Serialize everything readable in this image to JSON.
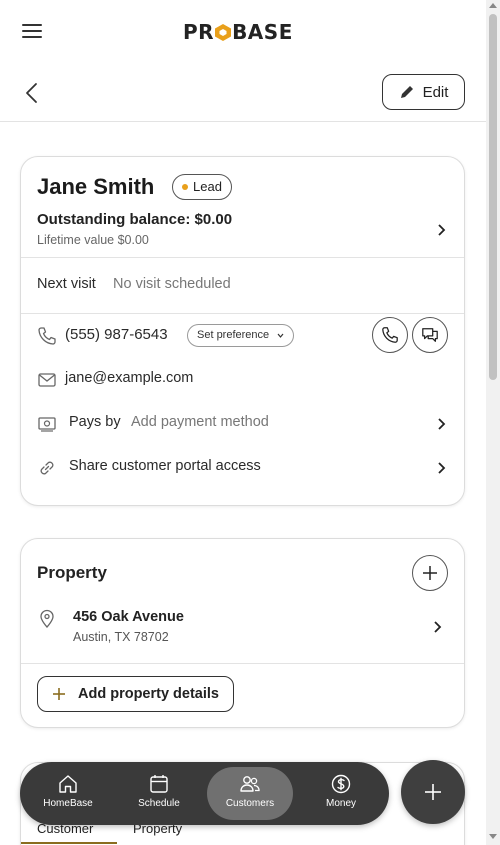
{
  "header": {
    "logo_text_left": "PR",
    "logo_text_right": "BASE",
    "edit_label": "Edit"
  },
  "customer": {
    "name": "Jane Smith",
    "status_badge": "Lead",
    "outstanding_balance": "Outstanding balance: $0.00",
    "lifetime_value": "Lifetime value $0.00",
    "next_visit_label": "Next visit",
    "next_visit_value": "No visit scheduled",
    "phone": "(555) 987-6543",
    "set_preference_label": "Set preference",
    "email": "jane@example.com",
    "pays_by_label": "Pays by",
    "pays_by_value": "Add payment method",
    "portal_label": "Share customer portal access"
  },
  "property": {
    "title": "Property",
    "address_line1": "456 Oak Avenue",
    "address_line2": "Austin, TX 78702",
    "add_details_label": "Add property details"
  },
  "tabs": [
    {
      "label": "Customer",
      "active": true
    },
    {
      "label": "Property",
      "active": false
    }
  ],
  "bottom_nav": [
    {
      "label": "HomeBase",
      "icon": "home-icon",
      "active": false
    },
    {
      "label": "Schedule",
      "icon": "calendar-icon",
      "active": false
    },
    {
      "label": "Customers",
      "icon": "users-icon",
      "active": true
    },
    {
      "label": "Money",
      "icon": "dollar-icon",
      "active": false
    }
  ],
  "colors": {
    "accent": "#e9a01b",
    "nav_background": "#3a3a3a",
    "nav_active": "#707070",
    "tab_underline": "#8a6d1f"
  }
}
